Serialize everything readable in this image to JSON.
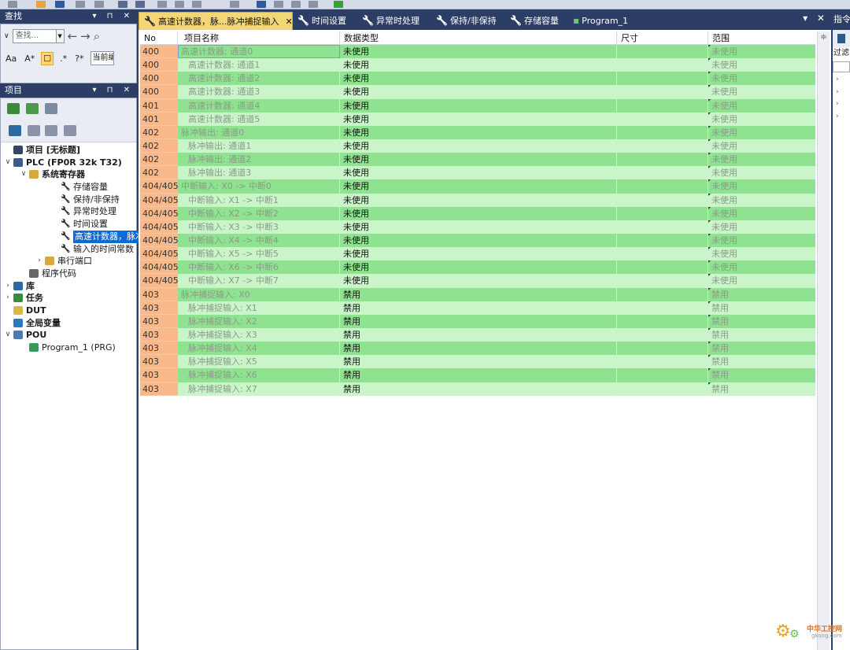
{
  "find_panel": {
    "title": "查找",
    "controls": "▾ ⊓ ✕",
    "search_placeholder": "查找...",
    "scope_value": "当前编",
    "options": [
      "Aa",
      "A*",
      "☐",
      ".*",
      "?*"
    ]
  },
  "project_panel": {
    "title": "项目",
    "controls": "▾ ⊓ ✕",
    "tree": [
      {
        "label": "项目 [无标题]",
        "level": 0,
        "bold": true,
        "arrow": "",
        "icon": "project-icon"
      },
      {
        "label": "PLC (FP0R 32k T32)",
        "level": 0,
        "bold": true,
        "arrow": "∨",
        "icon": "plc-icon"
      },
      {
        "label": "系统寄存器",
        "level": 1,
        "bold": true,
        "arrow": "∨",
        "icon": "folder-icon"
      },
      {
        "label": "存储容量",
        "level": 3,
        "bold": false,
        "arrow": "",
        "icon": "wrench-icon"
      },
      {
        "label": "保持/非保持",
        "level": 3,
        "bold": false,
        "arrow": "",
        "icon": "wrench-icon"
      },
      {
        "label": "异常时处理",
        "level": 3,
        "bold": false,
        "arrow": "",
        "icon": "wrench-icon"
      },
      {
        "label": "时间设置",
        "level": 3,
        "bold": false,
        "arrow": "",
        "icon": "wrench-icon"
      },
      {
        "label": "高速计数器，脉冲",
        "level": 3,
        "bold": false,
        "arrow": "",
        "icon": "wrench-icon",
        "selected": true
      },
      {
        "label": "输入的时间常数",
        "level": 3,
        "bold": false,
        "arrow": "",
        "icon": "wrench-icon"
      },
      {
        "label": "串行端口",
        "level": 2,
        "bold": false,
        "arrow": "›",
        "icon": "folder-icon"
      },
      {
        "label": "程序代码",
        "level": 1,
        "bold": false,
        "arrow": "",
        "icon": "code-icon"
      },
      {
        "label": "库",
        "level": 0,
        "bold": true,
        "arrow": "›",
        "icon": "library-icon"
      },
      {
        "label": "任务",
        "level": 0,
        "bold": true,
        "arrow": "›",
        "icon": "task-icon"
      },
      {
        "label": "DUT",
        "level": 0,
        "bold": true,
        "arrow": "",
        "icon": "dut-icon"
      },
      {
        "label": "全局变量",
        "level": 0,
        "bold": true,
        "arrow": "",
        "icon": "global-var-icon"
      },
      {
        "label": "POU",
        "level": 0,
        "bold": true,
        "arrow": "∨",
        "icon": "pou-icon"
      },
      {
        "label": "Program_1 (PRG)",
        "level": 1,
        "bold": false,
        "arrow": "",
        "icon": "program-icon"
      }
    ]
  },
  "tabs": [
    {
      "label": "高速计数器，脉...脉冲捕捉输入",
      "active": true,
      "icon": "wrench-icon",
      "close": "✕"
    },
    {
      "label": "时间设置",
      "active": false,
      "icon": "wrench-icon"
    },
    {
      "label": "异常时处理",
      "active": false,
      "icon": "wrench-icon"
    },
    {
      "label": "保持/非保持",
      "active": false,
      "icon": "wrench-icon"
    },
    {
      "label": "存储容量",
      "active": false,
      "icon": "wrench-icon"
    },
    {
      "label": "Program_1",
      "active": false,
      "icon": "program-icon"
    }
  ],
  "tab_controls": "▾ ✕",
  "table": {
    "headers": [
      "No",
      "项目名称",
      "数据类型",
      "尺寸",
      "范围"
    ],
    "rows": [
      {
        "no": "400",
        "name": "高速计数器: 通道0",
        "type": "未使用",
        "size": "",
        "range": "未使用",
        "indent": false
      },
      {
        "no": "400",
        "name": "高速计数器: 通道1",
        "type": "未使用",
        "size": "",
        "range": "未使用",
        "indent": true
      },
      {
        "no": "400",
        "name": "高速计数器: 通道2",
        "type": "未使用",
        "size": "",
        "range": "未使用",
        "indent": true
      },
      {
        "no": "400",
        "name": "高速计数器: 通道3",
        "type": "未使用",
        "size": "",
        "range": "未使用",
        "indent": true
      },
      {
        "no": "401",
        "name": "高速计数器: 通道4",
        "type": "未使用",
        "size": "",
        "range": "未使用",
        "indent": true
      },
      {
        "no": "401",
        "name": "高速计数器: 通道5",
        "type": "未使用",
        "size": "",
        "range": "未使用",
        "indent": true
      },
      {
        "no": "402",
        "name": "脉冲输出: 通道0",
        "type": "未使用",
        "size": "",
        "range": "未使用",
        "indent": false
      },
      {
        "no": "402",
        "name": "脉冲输出: 通道1",
        "type": "未使用",
        "size": "",
        "range": "未使用",
        "indent": true
      },
      {
        "no": "402",
        "name": "脉冲输出: 通道2",
        "type": "未使用",
        "size": "",
        "range": "未使用",
        "indent": true
      },
      {
        "no": "402",
        "name": "脉冲输出: 通道3",
        "type": "未使用",
        "size": "",
        "range": "未使用",
        "indent": true
      },
      {
        "no": "404/405",
        "name": "中断输入: X0 -> 中断0",
        "type": "未使用",
        "size": "",
        "range": "未使用",
        "indent": false
      },
      {
        "no": "404/405",
        "name": "中断输入: X1 -> 中断1",
        "type": "未使用",
        "size": "",
        "range": "未使用",
        "indent": true
      },
      {
        "no": "404/405",
        "name": "中断输入: X2 -> 中断2",
        "type": "未使用",
        "size": "",
        "range": "未使用",
        "indent": true
      },
      {
        "no": "404/405",
        "name": "中断输入: X3 -> 中断3",
        "type": "未使用",
        "size": "",
        "range": "未使用",
        "indent": true
      },
      {
        "no": "404/405",
        "name": "中断输入: X4 -> 中断4",
        "type": "未使用",
        "size": "",
        "range": "未使用",
        "indent": true
      },
      {
        "no": "404/405",
        "name": "中断输入: X5 -> 中断5",
        "type": "未使用",
        "size": "",
        "range": "未使用",
        "indent": true
      },
      {
        "no": "404/405",
        "name": "中断输入: X6 -> 中断6",
        "type": "未使用",
        "size": "",
        "range": "未使用",
        "indent": true
      },
      {
        "no": "404/405",
        "name": "中断输入: X7 -> 中断7",
        "type": "未使用",
        "size": "",
        "range": "未使用",
        "indent": true
      },
      {
        "no": "403",
        "name": "脉冲捕捉输入: X0",
        "type": "禁用",
        "size": "",
        "range": "禁用",
        "indent": false
      },
      {
        "no": "403",
        "name": "脉冲捕捉输入: X1",
        "type": "禁用",
        "size": "",
        "range": "禁用",
        "indent": true
      },
      {
        "no": "403",
        "name": "脉冲捕捉输入: X2",
        "type": "禁用",
        "size": "",
        "range": "禁用",
        "indent": true
      },
      {
        "no": "403",
        "name": "脉冲捕捉输入: X3",
        "type": "禁用",
        "size": "",
        "range": "禁用",
        "indent": true
      },
      {
        "no": "403",
        "name": "脉冲捕捉输入: X4",
        "type": "禁用",
        "size": "",
        "range": "禁用",
        "indent": true
      },
      {
        "no": "403",
        "name": "脉冲捕捉输入: X5",
        "type": "禁用",
        "size": "",
        "range": "禁用",
        "indent": true
      },
      {
        "no": "403",
        "name": "脉冲捕捉输入: X6",
        "type": "禁用",
        "size": "",
        "range": "禁用",
        "indent": true
      },
      {
        "no": "403",
        "name": "脉冲捕捉输入: X7",
        "type": "禁用",
        "size": "",
        "range": "禁用",
        "indent": true
      }
    ]
  },
  "right_panel": {
    "title": "指令",
    "filter_label": "过滤"
  },
  "watermark": {
    "text": "中华工控网",
    "sub": "gkong.com"
  },
  "colors": {
    "frame": "#2c3e66",
    "active_tab": "#f3d675",
    "row_green_dark": "#8fe28f",
    "row_green_light": "#c9f5c9",
    "no_column": "#f9b98a",
    "selection": "#0a6ad8"
  }
}
